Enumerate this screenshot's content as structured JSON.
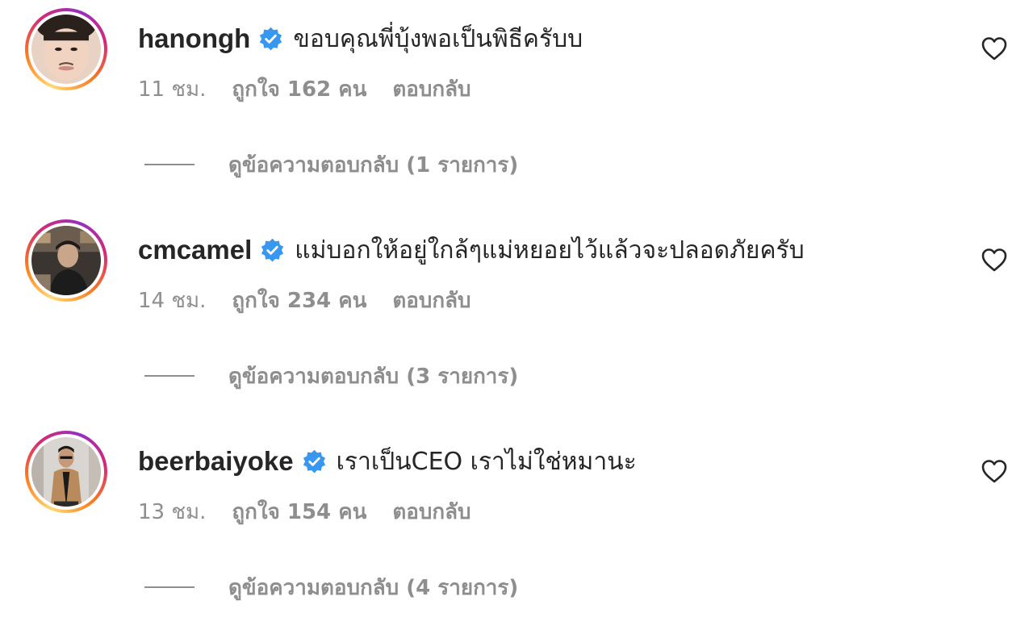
{
  "colors": {
    "text_primary": "#262626",
    "text_secondary": "#8e8e8e",
    "verified_blue": "#3897f0",
    "story_ring": [
      "#feda75",
      "#fa7e1e",
      "#d62976",
      "#962fbf"
    ]
  },
  "comments": [
    {
      "username": "hanongh",
      "verified": true,
      "text": "ขอบคุณพี่บุ้งพอเป็นพิธีครับบ",
      "time": "11 ชม.",
      "likes": "ถูกใจ 162 คน",
      "reply_label": "ตอบกลับ",
      "view_replies": "ดูข้อความตอบกลับ (1 รายการ)",
      "like_icon": "heart-outline-icon"
    },
    {
      "username": "cmcamel",
      "verified": true,
      "text": "แม่บอกให้อยู่ใกล้ๆแม่หยอยไว้แล้วจะปลอดภัยครับ",
      "time": "14 ชม.",
      "likes": "ถูกใจ 234 คน",
      "reply_label": "ตอบกลับ",
      "view_replies": "ดูข้อความตอบกลับ (3 รายการ)",
      "like_icon": "heart-outline-icon"
    },
    {
      "username": "beerbaiyoke",
      "verified": true,
      "text": "เราเป็นCEO เราไม่ใช่หมานะ",
      "time": "13 ชม.",
      "likes": "ถูกใจ 154 คน",
      "reply_label": "ตอบกลับ",
      "view_replies": "ดูข้อความตอบกลับ (4 รายการ)",
      "like_icon": "heart-outline-icon"
    }
  ]
}
